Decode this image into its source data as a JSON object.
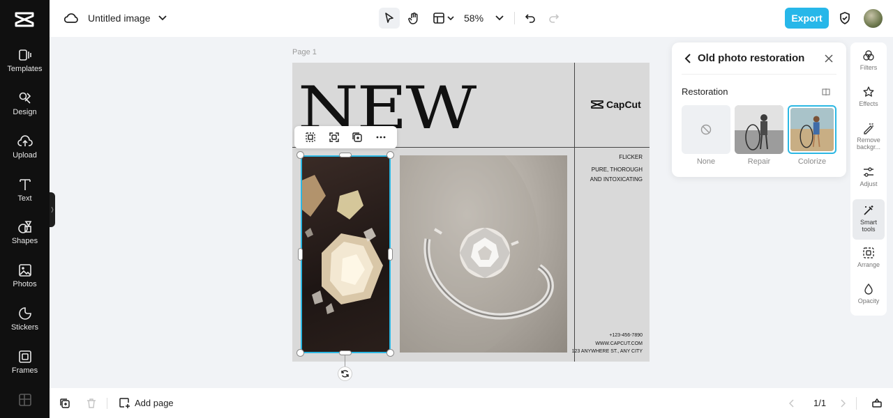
{
  "sidebar": {
    "items": [
      {
        "label": "Templates",
        "icon": "templates-icon"
      },
      {
        "label": "Design",
        "icon": "design-icon"
      },
      {
        "label": "Upload",
        "icon": "upload-icon"
      },
      {
        "label": "Text",
        "icon": "text-icon"
      },
      {
        "label": "Shapes",
        "icon": "shapes-icon"
      },
      {
        "label": "Photos",
        "icon": "photos-icon"
      },
      {
        "label": "Stickers",
        "icon": "stickers-icon"
      },
      {
        "label": "Frames",
        "icon": "frames-icon"
      }
    ]
  },
  "topbar": {
    "title": "Untitled image",
    "zoom": "58%",
    "export_label": "Export"
  },
  "canvas": {
    "page_label": "Page 1",
    "headline": "NEW",
    "brand": "CapCut",
    "text_lines": [
      "FLICKER",
      "PURE, THOROUGH",
      "AND INTOXICATING"
    ],
    "contact_lines": [
      "+123-456-7890",
      "WWW.CAPCUT.COM",
      "123 ANYWHERE ST., ANY CITY"
    ]
  },
  "panel": {
    "title": "Old photo restoration",
    "section": "Restoration",
    "options": [
      {
        "label": "None",
        "selected": false
      },
      {
        "label": "Repair",
        "selected": false
      },
      {
        "label": "Colorize",
        "selected": true
      }
    ]
  },
  "right_tools": [
    {
      "label": "Filters",
      "icon": "filters-icon"
    },
    {
      "label": "Effects",
      "icon": "effects-icon"
    },
    {
      "label": "Remove backgr...",
      "icon": "remove-background-icon"
    },
    {
      "label": "Adjust",
      "icon": "adjust-icon"
    },
    {
      "label": "Smart tools",
      "icon": "smart-tools-icon",
      "active": true
    },
    {
      "label": "Arrange",
      "icon": "arrange-icon"
    },
    {
      "label": "Opacity",
      "icon": "opacity-icon"
    }
  ],
  "bottombar": {
    "add_page_label": "Add page",
    "page_indicator": "1/1"
  },
  "colors": {
    "accent": "#27b7e9",
    "selection": "#2bb7e3",
    "sidebar_bg": "#101010"
  }
}
